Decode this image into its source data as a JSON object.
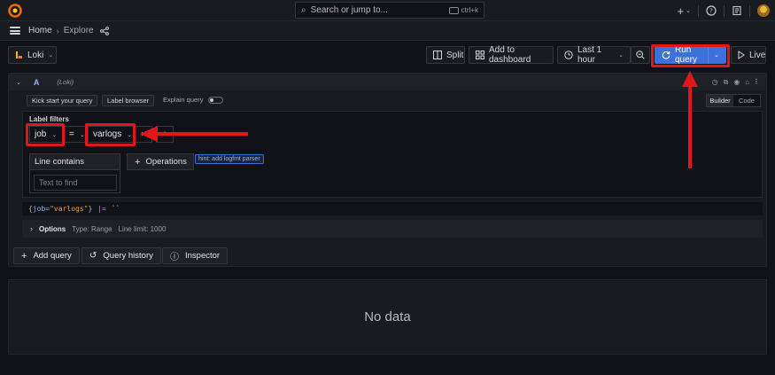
{
  "topbar": {
    "search_placeholder": "Search or jump to...",
    "search_shortcut": "ctrl+k",
    "plus_label": "+"
  },
  "breadcrumb": {
    "home": "Home",
    "explore": "Explore"
  },
  "toolbar": {
    "datasource": "Loki",
    "split": "Split",
    "add_to_dashboard": "Add to dashboard",
    "time_range": "Last 1 hour",
    "run_query": "Run query",
    "live": "Live"
  },
  "query": {
    "ref": "A",
    "datasource_tag": "(Loki)",
    "kick_start": "Kick start your query",
    "label_browser": "Label browser",
    "explain_query": "Explain query",
    "modes": [
      "Builder",
      "Code"
    ],
    "label_filters_title": "Label filters",
    "label_name": "job",
    "operator": "=",
    "label_value": "varlogs",
    "line_contains_title": "Line contains",
    "line_contains_placeholder": "Text to find",
    "operations": "Operations",
    "hint": "hint: add logfmt parser",
    "preview": {
      "open": "{",
      "key": "job",
      "eq": "=",
      "val": "\"varlogs\"",
      "close": "}",
      "pipe": "|=",
      "str": "``"
    },
    "options": {
      "label": "Options",
      "type": "Type: Range",
      "line_limit": "Line limit: 1000"
    }
  },
  "actions": {
    "add_query": "Add query",
    "query_history": "Query history",
    "inspector": "Inspector"
  },
  "results": {
    "empty": "No data"
  },
  "colors": {
    "accent": "#3d71d9",
    "annotation": "#e1171c",
    "background": "#111217",
    "panel": "#181b1f"
  }
}
